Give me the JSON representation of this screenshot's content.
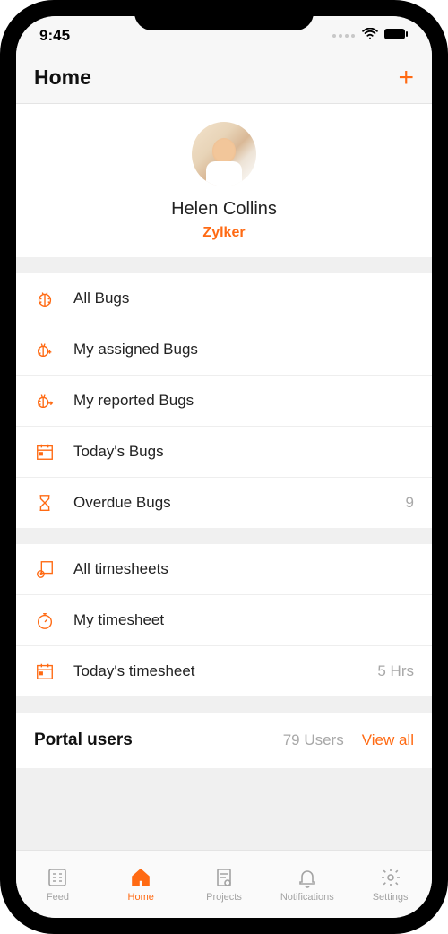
{
  "status": {
    "time": "9:45"
  },
  "header": {
    "title": "Home"
  },
  "profile": {
    "name": "Helen Collins",
    "org": "Zylker"
  },
  "bug_list": [
    {
      "label": "All Bugs",
      "badge": ""
    },
    {
      "label": "My assigned Bugs",
      "badge": ""
    },
    {
      "label": "My reported Bugs",
      "badge": ""
    },
    {
      "label": "Today's Bugs",
      "badge": ""
    },
    {
      "label": "Overdue Bugs",
      "badge": "9"
    }
  ],
  "timesheet_list": [
    {
      "label": "All timesheets",
      "badge": ""
    },
    {
      "label": "My timesheet",
      "badge": ""
    },
    {
      "label": "Today's timesheet",
      "badge": "5 Hrs"
    }
  ],
  "portal": {
    "title": "Portal users",
    "count": "79 Users",
    "view_all": "View all"
  },
  "tabs": [
    {
      "label": "Feed"
    },
    {
      "label": "Home"
    },
    {
      "label": "Projects"
    },
    {
      "label": "Notifications"
    },
    {
      "label": "Settings"
    }
  ]
}
